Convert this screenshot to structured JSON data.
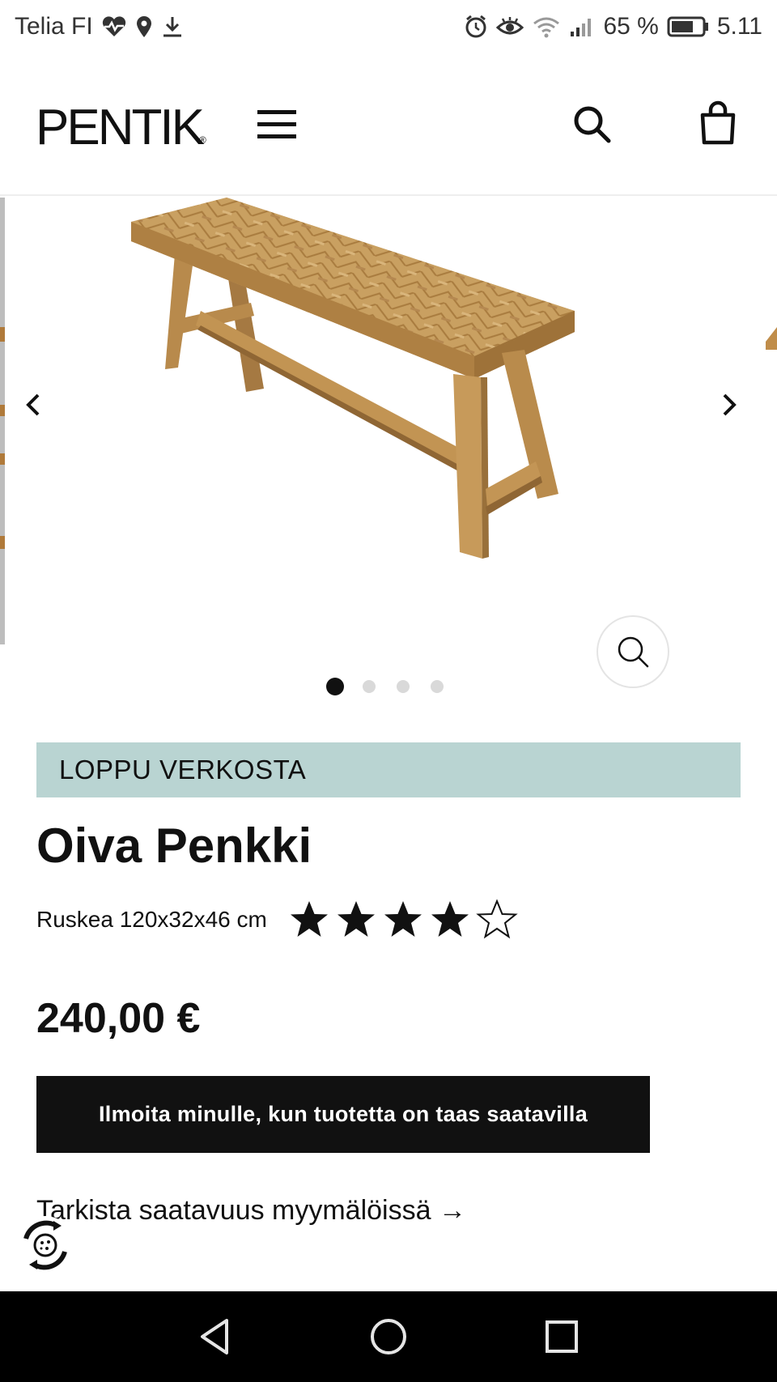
{
  "status_bar": {
    "carrier": "Telia FI",
    "battery": "65 %",
    "time": "5.11",
    "left_icons": [
      "heart-pulse-icon",
      "location-icon",
      "download-icon"
    ],
    "right_icons": [
      "alarm-icon",
      "eye-icon",
      "wifi-icon",
      "signal-icon",
      "battery-icon"
    ]
  },
  "header": {
    "logo": "PENTIK",
    "logo_mark": "®",
    "icons": [
      "menu-icon",
      "search-icon",
      "shopping-bag-icon"
    ]
  },
  "gallery": {
    "image": "Oiva Penkki",
    "slide_count": 4,
    "active_slide": 1,
    "icons": [
      "chevron-left-icon",
      "chevron-right-icon",
      "zoom-icon"
    ]
  },
  "product": {
    "stock_label": "LOPPU VERKOSTA",
    "title": "Oiva Penkki",
    "variant": "Ruskea 120x32x46 cm",
    "rating": 4,
    "rating_max": 5,
    "price": "240,00 €",
    "notify_label": "Ilmoita minulle, kun tuotetta on taas saatavilla",
    "store_link": "Tarkista saatavuus myymälöissä →"
  },
  "colors": {
    "stock_banner": "#b9d4d2",
    "button": "#111111",
    "text": "#111111"
  },
  "navigation": {
    "icons": [
      "back-triangle-icon",
      "home-circle-icon",
      "recents-square-icon"
    ]
  }
}
